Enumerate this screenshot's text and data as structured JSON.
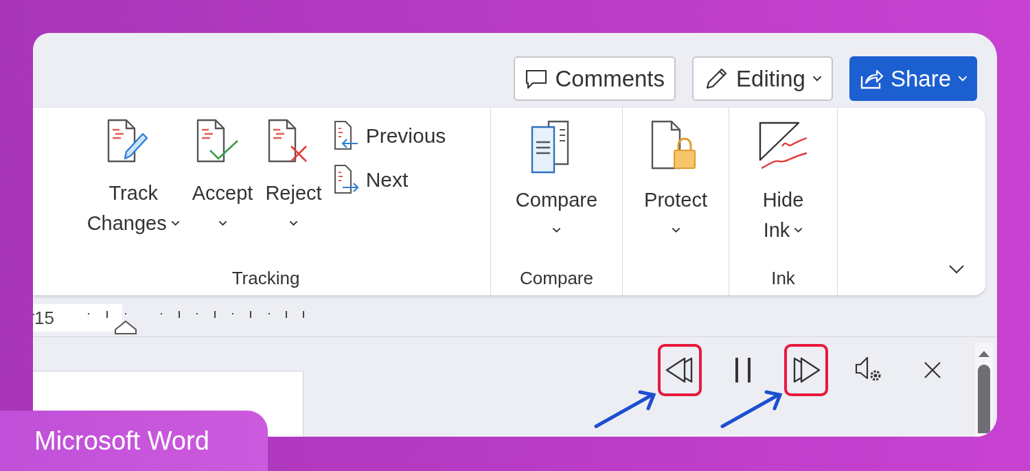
{
  "frame_label": "Microsoft Word",
  "header_buttons": [
    {
      "kind": "comments",
      "label": "Comments",
      "dropdown": false
    },
    {
      "kind": "editing",
      "label": "Editing",
      "dropdown": true
    },
    {
      "kind": "share",
      "label": "Share",
      "dropdown": true
    }
  ],
  "ribbon": {
    "groups": [
      {
        "label": "Tracking",
        "items": [
          {
            "kind": "large",
            "lines": [
              "Track",
              "Changes"
            ],
            "dropdown": true
          },
          {
            "kind": "large",
            "lines": [
              "Accept"
            ],
            "dropdown": true
          },
          {
            "kind": "large",
            "lines": [
              "Reject"
            ],
            "dropdown": true
          },
          {
            "kind": "small",
            "lines": [
              "Previous"
            ],
            "dropdown": false
          },
          {
            "kind": "small",
            "lines": [
              "Next"
            ],
            "dropdown": false
          }
        ]
      },
      {
        "label": "Compare",
        "items": [
          {
            "kind": "large",
            "lines": [
              "Compare"
            ],
            "dropdown": true
          }
        ]
      },
      {
        "items": [
          {
            "kind": "large",
            "lines": [
              "Protect"
            ],
            "dropdown": true
          }
        ]
      },
      {
        "label": "Ink",
        "items": [
          {
            "kind": "large",
            "lines": [
              "Hide",
              "Ink"
            ],
            "dropdown": true
          }
        ]
      }
    ]
  },
  "ruler": {
    "number": "15"
  },
  "read_aloud": [
    {
      "kind": "previous",
      "highlighted": true
    },
    {
      "kind": "pause",
      "highlighted": false
    },
    {
      "kind": "next",
      "highlighted": true
    },
    {
      "kind": "settings",
      "highlighted": false
    },
    {
      "kind": "close",
      "highlighted": false
    }
  ]
}
